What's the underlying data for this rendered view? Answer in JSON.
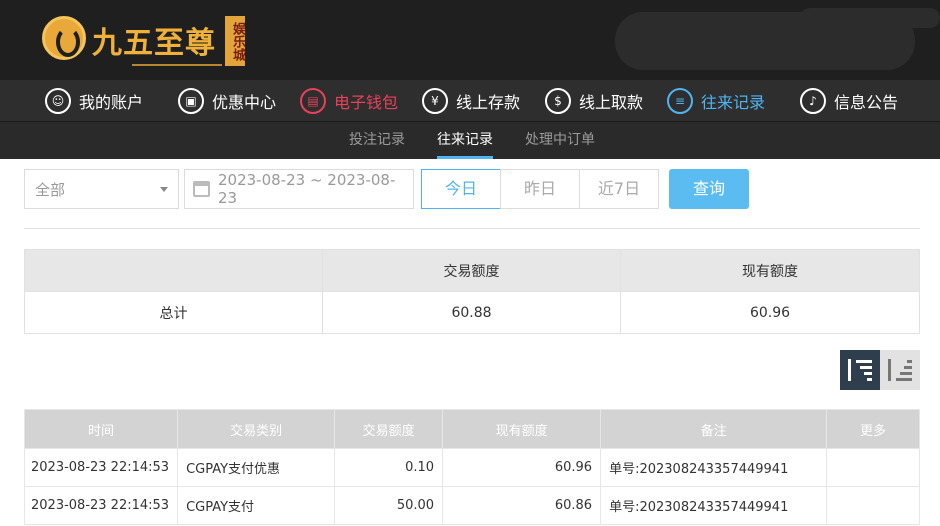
{
  "brand": {
    "name": "九五至尊",
    "badge": "娱乐城"
  },
  "nav": [
    {
      "label": "我的账户",
      "icon": "user-icon",
      "state": "default"
    },
    {
      "label": "优惠中心",
      "icon": "gift-icon",
      "state": "default"
    },
    {
      "label": "电子钱包",
      "icon": "wallet-icon",
      "state": "highlight"
    },
    {
      "label": "线上存款",
      "icon": "deposit-icon",
      "state": "default"
    },
    {
      "label": "线上取款",
      "icon": "withdraw-icon",
      "state": "default"
    },
    {
      "label": "往来记录",
      "icon": "record-icon",
      "state": "active"
    },
    {
      "label": "信息公告",
      "icon": "bell-icon",
      "state": "default"
    }
  ],
  "subnav": [
    {
      "label": "投注记录",
      "active": false
    },
    {
      "label": "往来记录",
      "active": true
    },
    {
      "label": "处理中订单",
      "active": false
    }
  ],
  "filter": {
    "category": "全部",
    "date_range": "2023-08-23 ~ 2023-08-23",
    "quick_dates": [
      "今日",
      "昨日",
      "近7日"
    ],
    "active_quick": "今日",
    "query_label": "查询"
  },
  "summary": {
    "headers": [
      "",
      "交易额度",
      "现有额度"
    ],
    "row": {
      "label": "总计",
      "amount": "60.88",
      "balance": "60.96"
    }
  },
  "table": {
    "headers": [
      "时间",
      "交易类别",
      "交易额度",
      "现有额度",
      "备注",
      "更多"
    ],
    "rows": [
      {
        "time": "2023-08-23 22:14:53",
        "type": "CGPAY支付优惠",
        "amount": "0.10",
        "balance": "60.96",
        "note": "单号:202308243357449941",
        "more": ""
      },
      {
        "time": "2023-08-23 22:14:53",
        "type": "CGPAY支付",
        "amount": "50.00",
        "balance": "60.86",
        "note": "单号:202308243357449941",
        "more": ""
      }
    ]
  },
  "colors": {
    "accent": "#4fb4f0",
    "highlight": "#e8415a",
    "brand_gold": "#f0b13a",
    "header_bg": "#1f1f1f"
  }
}
